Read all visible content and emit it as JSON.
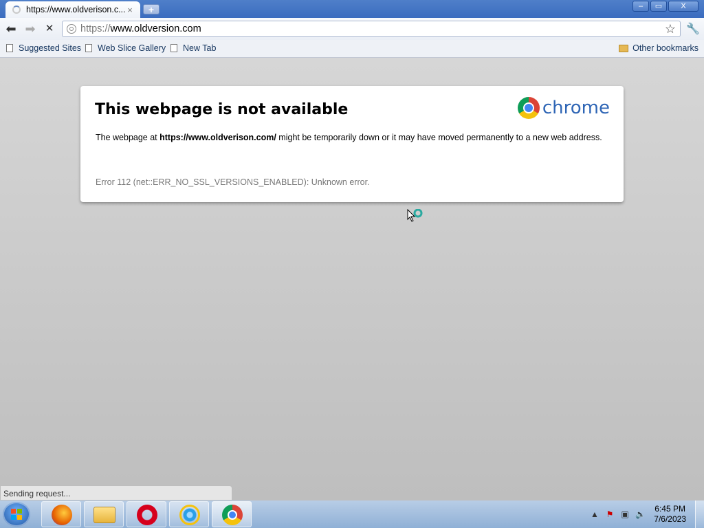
{
  "window": {
    "tab_title": "https://www.oldverison.c...",
    "tab_close": "×",
    "new_tab": "+",
    "min": "–",
    "max": "▭",
    "close": "X"
  },
  "toolbar": {
    "back": "⬅",
    "forward": "➡",
    "stop": "✕",
    "url_scheme": "https://",
    "url_rest": "www.oldversion.com",
    "star": "☆",
    "wrench": "🔧"
  },
  "bookmarks": {
    "items": [
      "Suggested Sites",
      "Web Slice Gallery",
      "New Tab"
    ],
    "other": "Other bookmarks"
  },
  "error": {
    "title": "This webpage is not available",
    "logo_text": "chrome",
    "desc_pre": "The webpage at ",
    "desc_url": "https://www.oldverison.com/",
    "desc_post": " might be temporarily down or it may have moved permanently to a new web address.",
    "code": "Error 112 (net::ERR_NO_SSL_VERSIONS_ENABLED): Unknown error."
  },
  "status": "Sending request...",
  "taskbar": {
    "time": "6:45 PM",
    "date": "7/6/2023",
    "tray_arrow": "▲",
    "tray_flag": "⚑",
    "tray_network": "▣",
    "tray_volume": "🔈"
  }
}
